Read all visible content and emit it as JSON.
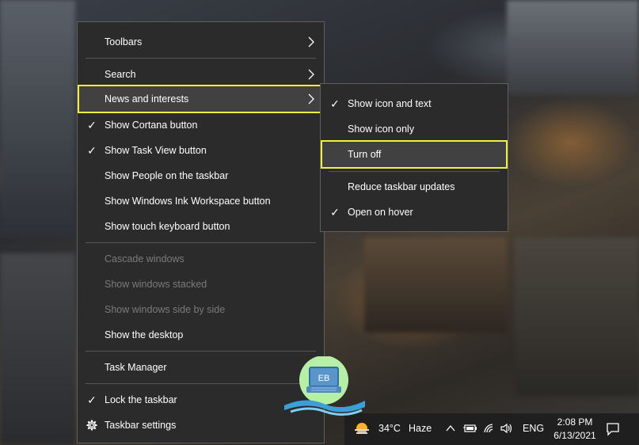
{
  "main_menu": {
    "items": [
      {
        "label": "Toolbars"
      },
      {
        "label": "Search"
      },
      {
        "label": "News and interests"
      },
      {
        "label": "Show Cortana button"
      },
      {
        "label": "Show Task View button"
      },
      {
        "label": "Show People on the taskbar"
      },
      {
        "label": "Show Windows Ink Workspace button"
      },
      {
        "label": "Show touch keyboard button"
      },
      {
        "label": "Cascade windows"
      },
      {
        "label": "Show windows stacked"
      },
      {
        "label": "Show windows side by side"
      },
      {
        "label": "Show the desktop"
      },
      {
        "label": "Task Manager"
      },
      {
        "label": "Lock the taskbar"
      },
      {
        "label": "Taskbar settings"
      }
    ]
  },
  "sub_menu": {
    "items": [
      {
        "label": "Show icon and text"
      },
      {
        "label": "Show icon only"
      },
      {
        "label": "Turn off"
      },
      {
        "label": "Reduce taskbar updates"
      },
      {
        "label": "Open on hover"
      }
    ]
  },
  "taskbar": {
    "weather_temp": "34°C",
    "weather_text": "Haze",
    "language": "ENG",
    "time": "2:08 PM",
    "date": "6/13/2021"
  },
  "watermark": {
    "text": "EB"
  },
  "colors": {
    "menu_bg": "#2b2b2b",
    "highlight_outline": "#f1f33a",
    "taskbar_bg": "#1f1f1f"
  }
}
